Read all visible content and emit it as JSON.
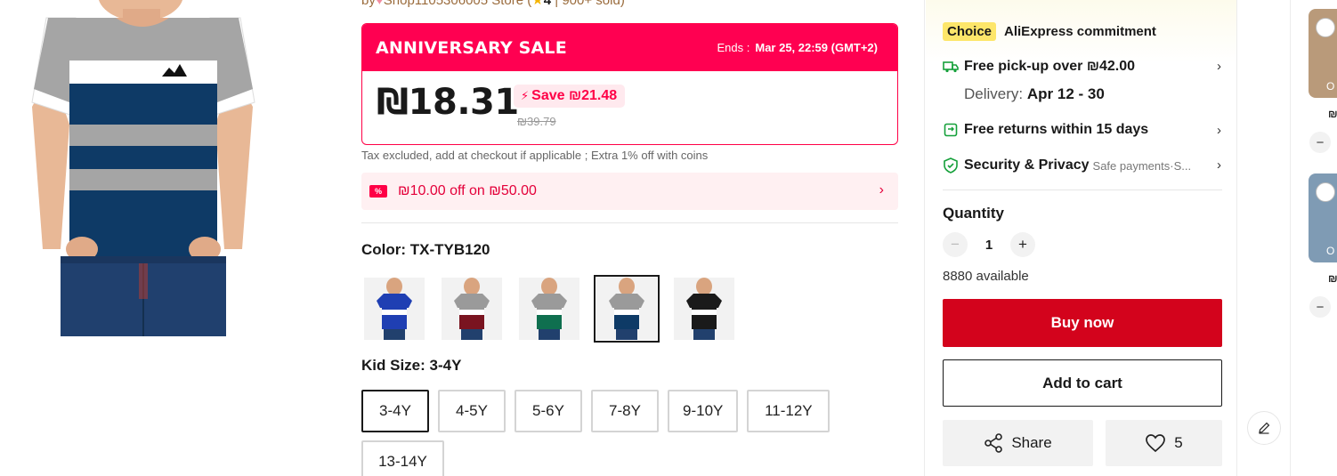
{
  "store": {
    "prefix": "by",
    "name": "Shop1105306005 Store",
    "rating": "4",
    "sold": "900+ sold"
  },
  "sale": {
    "title": "ANNIVERSARY SALE",
    "ends_label": "Ends :",
    "ends_value": "Mar 25, 22:59 (GMT+2)",
    "price": "₪18.31",
    "save": "Save ₪21.48",
    "original_price": "₪39.79"
  },
  "tax_note": "Tax excluded, add at checkout if applicable ; Extra 1% off with coins",
  "coupon": {
    "icon": "%",
    "text": "₪10.00 off on ₪50.00"
  },
  "color": {
    "label": "Color: TX-TYB120",
    "selected_index": 3,
    "options": [
      {
        "name": "blue-white-stripes",
        "top": "#1f3fb3",
        "band": "#ffffff",
        "bottom": "#1f3fb3"
      },
      {
        "name": "gray-maroon",
        "top": "#9a9a9a",
        "band": "#ffffff",
        "bottom": "#7a1420"
      },
      {
        "name": "gray-green",
        "top": "#9a9a9a",
        "band": "#ffffff",
        "bottom": "#0f6f4f"
      },
      {
        "name": "gray-navy",
        "top": "#9a9a9a",
        "band": "#ffffff",
        "bottom": "#0e3a66"
      },
      {
        "name": "black-white-pinstripe",
        "top": "#1a1a1a",
        "band": "#ffffff",
        "bottom": "#1a1a1a"
      }
    ]
  },
  "size": {
    "label": "Kid Size: 3-4Y",
    "selected_index": 0,
    "options": [
      "3-4Y",
      "4-5Y",
      "5-6Y",
      "7-8Y",
      "9-10Y",
      "11-12Y",
      "13-14Y"
    ]
  },
  "commitment": {
    "choice_tag": "Choice",
    "title": "AliExpress commitment",
    "pickup": "Free pick-up over ₪42.00",
    "delivery_label": "Delivery:",
    "delivery_value": "Apr 12 - 30",
    "returns": "Free returns within 15 days",
    "security": "Security & Privacy",
    "security_sub": "Safe payments·S..."
  },
  "quantity": {
    "label": "Quantity",
    "minus": "−",
    "value": "1",
    "plus": "+",
    "available": "8880 available"
  },
  "actions": {
    "buy": "Buy now",
    "cart": "Add to cart",
    "share": "Share",
    "favorites": "5"
  },
  "side": {
    "thumb_label": "O",
    "price_prefix": "₪",
    "minus": "−"
  },
  "colors": {
    "sale_red": "#ff0051",
    "buy_red": "#d3031c",
    "choice_yellow": "#fde66a",
    "green_icon": "#15a03a",
    "shirt_gray": "#9e9e9e",
    "shirt_navy": "#0e3a66"
  }
}
